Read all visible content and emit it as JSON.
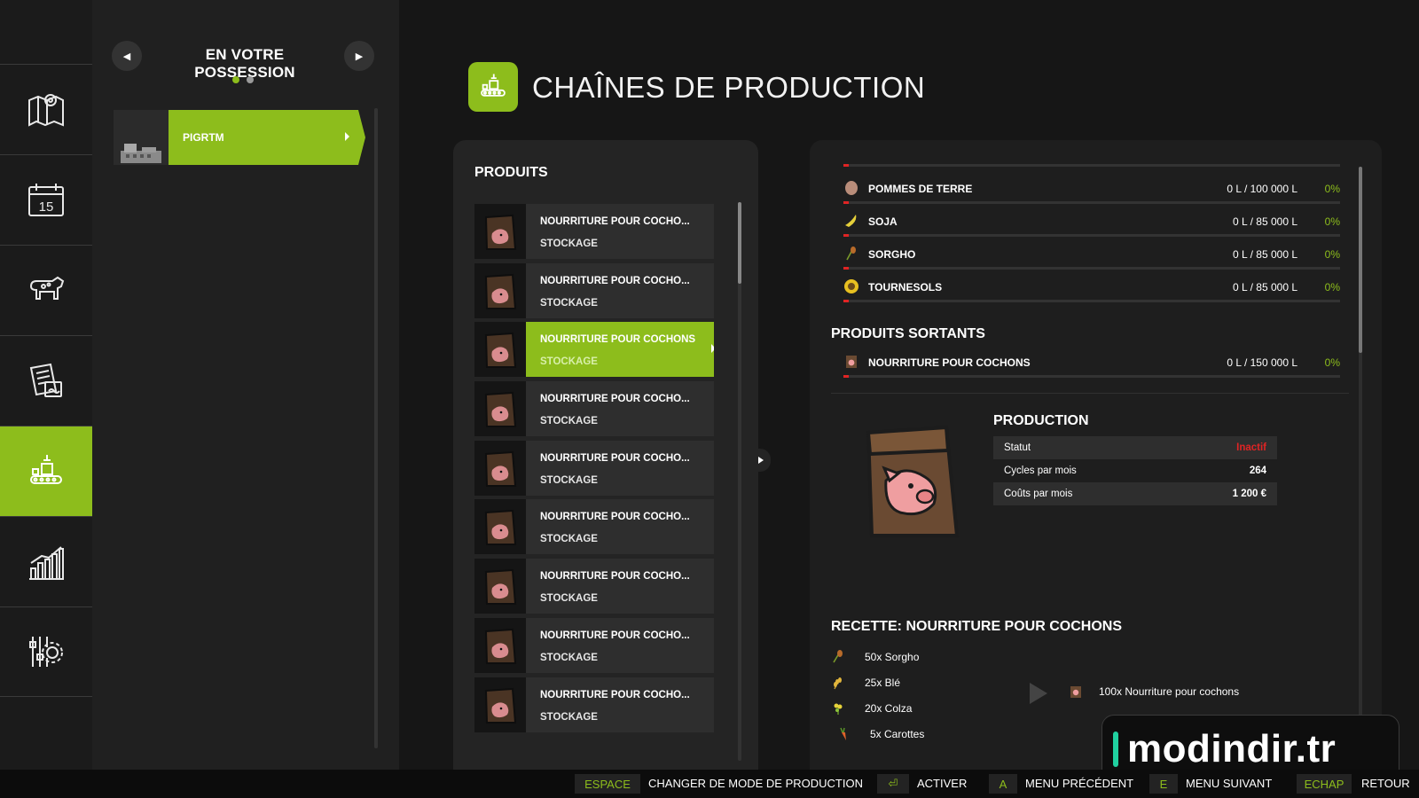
{
  "rail": {
    "items": [
      {
        "icon": "map-icon"
      },
      {
        "icon": "calendar-icon",
        "text": "15"
      },
      {
        "icon": "animals-icon"
      },
      {
        "icon": "contracts-icon"
      },
      {
        "icon": "production-icon",
        "active": true
      },
      {
        "icon": "statistics-icon"
      },
      {
        "icon": "settings-icon"
      }
    ]
  },
  "owned": {
    "title": "EN VOTRE POSSESSION",
    "item_label": "PIGRTM"
  },
  "header": {
    "title": "CHAÎNES DE PRODUCTION"
  },
  "products": {
    "title": "PRODUITS",
    "rows": [
      {
        "name": "NOURRITURE POUR COCHO...",
        "sub": "STOCKAGE"
      },
      {
        "name": "NOURRITURE POUR COCHO...",
        "sub": "STOCKAGE"
      },
      {
        "name": "NOURRITURE POUR COCHONS",
        "sub": "STOCKAGE",
        "selected": true
      },
      {
        "name": "NOURRITURE POUR COCHO...",
        "sub": "STOCKAGE"
      },
      {
        "name": "NOURRITURE POUR COCHO...",
        "sub": "STOCKAGE"
      },
      {
        "name": "NOURRITURE POUR COCHO...",
        "sub": "STOCKAGE"
      },
      {
        "name": "NOURRITURE POUR COCHO...",
        "sub": "STOCKAGE"
      },
      {
        "name": "NOURRITURE POUR COCHO...",
        "sub": "STOCKAGE"
      },
      {
        "name": "NOURRITURE POUR COCHO...",
        "sub": "STOCKAGE"
      }
    ]
  },
  "inputs": [
    {
      "name": "POMMES DE TERRE",
      "amount": "0 L / 100 000 L",
      "pct": "0%",
      "icon": "potato-icon"
    },
    {
      "name": "SOJA",
      "amount": "0 L / 85 000 L",
      "pct": "0%",
      "icon": "soybean-icon"
    },
    {
      "name": "SORGHO",
      "amount": "0 L / 85 000 L",
      "pct": "0%",
      "icon": "sorghum-icon"
    },
    {
      "name": "TOURNESOLS",
      "amount": "0 L / 85 000 L",
      "pct": "0%",
      "icon": "sunflower-icon"
    }
  ],
  "outputs": {
    "title": "PRODUITS SORTANTS",
    "rows": [
      {
        "name": "NOURRITURE POUR COCHONS",
        "amount": "0 L / 150 000 L",
        "pct": "0%",
        "icon": "pig-food-icon"
      }
    ]
  },
  "production": {
    "title": "PRODUCTION",
    "stats": [
      {
        "label": "Statut",
        "value": "Inactif"
      },
      {
        "label": "Cycles par mois",
        "value": "264"
      },
      {
        "label": "Coûts par mois",
        "value": "1 200 €"
      }
    ]
  },
  "recipe": {
    "title": "RECETTE: NOURRITURE POUR COCHONS",
    "inputs": [
      "50x Sorgho",
      "25x Blé",
      "20x Colza",
      "5x Carottes"
    ],
    "output": "100x Nourriture pour cochons"
  },
  "watermark": "modindir.tr",
  "footer": [
    {
      "key": "ESPACE",
      "label": "CHANGER DE MODE DE PRODUCTION"
    },
    {
      "key": "⏎",
      "label": "ACTIVER"
    },
    {
      "key": "A",
      "label": "MENU PRÉCÉDENT"
    },
    {
      "key": "E",
      "label": "MENU SUIVANT"
    },
    {
      "key": "ECHAP",
      "label": "RETOUR"
    }
  ],
  "colors": {
    "accent": "#8dbd1c",
    "alert": "#e02424"
  }
}
